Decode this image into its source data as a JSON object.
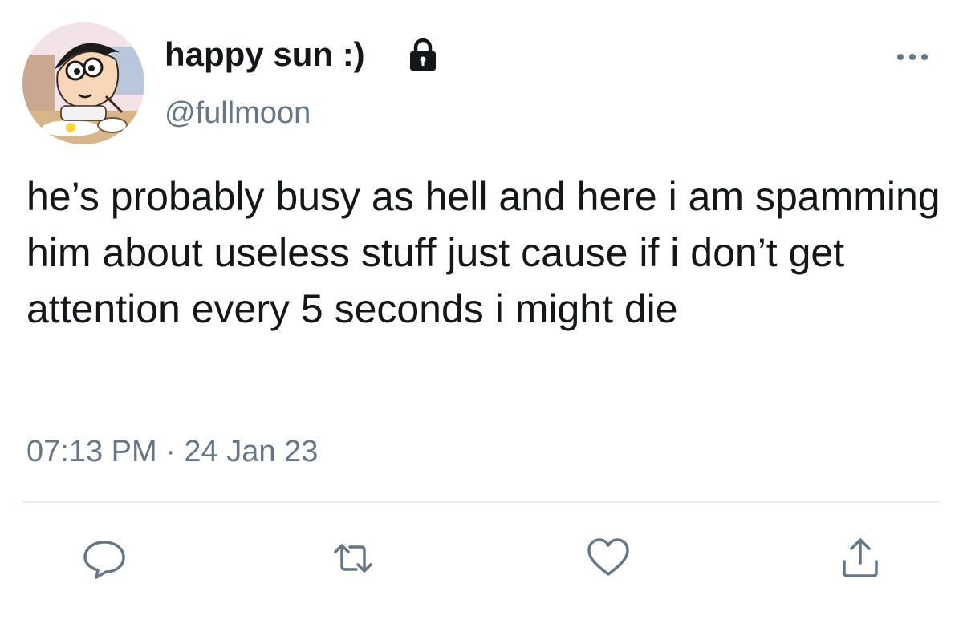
{
  "tweet": {
    "display_name": "happy sun :)",
    "handle": "@fullmoon",
    "text": "he’s probably busy as hell and here i am spamming him about useless stuff just cause if i don’t get attention every 5 seconds i might die",
    "timestamp": "07:13 PM · 24 Jan 23",
    "protected_icon": "lock-icon",
    "more_icon": "more-horizontal-icon"
  },
  "actions": [
    {
      "icon": "reply-icon"
    },
    {
      "icon": "retweet-icon"
    },
    {
      "icon": "like-icon"
    },
    {
      "icon": "share-icon"
    }
  ],
  "colors": {
    "text_primary": "#14171a",
    "text_secondary": "#657786",
    "icon": "#657786",
    "divider": "#e6ecf0"
  }
}
